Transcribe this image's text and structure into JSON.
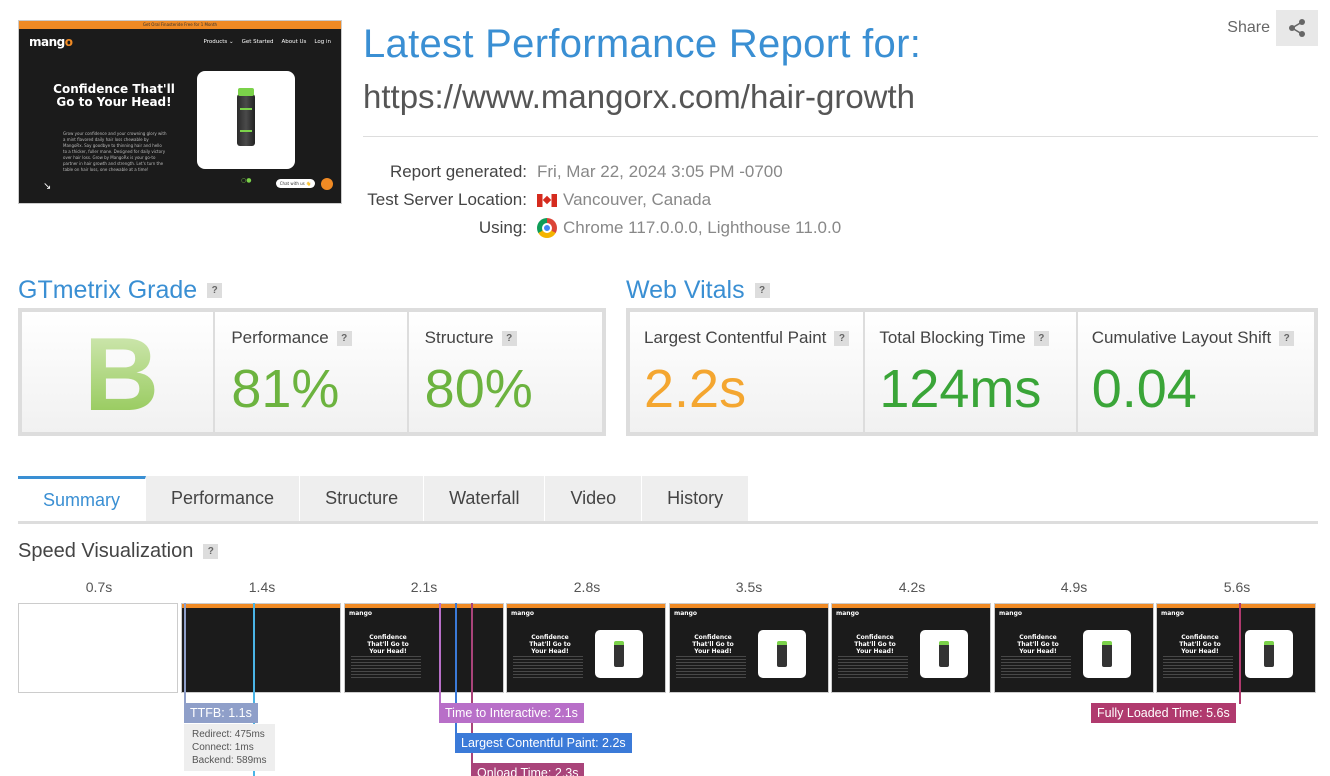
{
  "thumbnail": {
    "banner": "Get Oral Finasteride Free for 1 Month",
    "logo_main": "mang",
    "logo_accent": "o",
    "nav": [
      "Products ⌄",
      "Get Started",
      "About Us",
      "Log in"
    ],
    "hero_title": "Confidence That'll Go to Your Head!",
    "hero_body": "Grow your confidence and your crowning glory with a mint flavored daily hair loss chewable by MangoRx. Say goodbye to thinning hair and hello to a thicker, fuller mane. Designed for daily victory over hair loss. Grow by MangoRx is your go-to partner in hair growth and strength. Let's turn the table on hair loss, one chewable at a time!",
    "chat": "Chat with us 👋"
  },
  "header": {
    "title": "Latest Performance Report for:",
    "url": "https://www.mangorx.com/hair-growth",
    "share_label": "Share"
  },
  "meta": {
    "report_label": "Report generated:",
    "report_value": "Fri, Mar 22, 2024 3:05 PM -0700",
    "location_label": "Test Server Location:",
    "location_value": "Vancouver, Canada",
    "using_label": "Using:",
    "using_value": "Chrome 117.0.0.0, Lighthouse 11.0.0"
  },
  "grade": {
    "heading": "GTmetrix Grade",
    "letter": "B",
    "performance_label": "Performance",
    "performance_value": "81%",
    "structure_label": "Structure",
    "structure_value": "80%",
    "color": "#6cb33f"
  },
  "vitals": {
    "heading": "Web Vitals",
    "lcp_label": "Largest Contentful Paint",
    "lcp_value": "2.2s",
    "lcp_color": "#f4a630",
    "tbt_label": "Total Blocking Time",
    "tbt_value": "124ms",
    "tbt_color": "#3aa538",
    "cls_label": "Cumulative Layout Shift",
    "cls_value": "0.04",
    "cls_color": "#3aa538"
  },
  "tabs": [
    "Summary",
    "Performance",
    "Structure",
    "Waterfall",
    "Video",
    "History"
  ],
  "speed": {
    "heading": "Speed Visualization",
    "times": [
      "0.7s",
      "1.4s",
      "2.1s",
      "2.8s",
      "3.5s",
      "4.2s",
      "4.9s",
      "5.6s"
    ],
    "ttfb": "TTFB: 1.1s",
    "ttfb_redirect": "Redirect: 475ms",
    "ttfb_connect": "Connect: 1ms",
    "ttfb_backend": "Backend: 589ms",
    "tti": "Time to Interactive: 2.1s",
    "lcp": "Largest Contentful Paint: 2.2s",
    "onload": "Onload Time: 2.3s",
    "fully_loaded": "Fully Loaded Time: 5.6s",
    "colors": {
      "ttfb": "#8f9fc9",
      "tti": "#b86fc8",
      "lcp": "#3b7ad8",
      "onload": "#a9447a",
      "fully": "#b03a6e",
      "ttfb_line": "#4ab4e6"
    }
  }
}
